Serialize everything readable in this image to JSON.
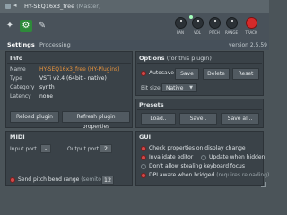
{
  "window": {
    "title": "HY-SEQ16x3_free",
    "title_suffix": "(Master)"
  },
  "header": {
    "knobs": [
      {
        "label": "PAN",
        "name": "pan"
      },
      {
        "label": "VOL",
        "name": "volume"
      },
      {
        "label": "PITCH",
        "name": "pitch"
      },
      {
        "label": "RANGE",
        "name": "range"
      },
      {
        "label": "TRACK",
        "name": "track"
      }
    ],
    "accent_color": "#2e8a3a"
  },
  "tabs": {
    "items": [
      "Settings",
      "Processing"
    ],
    "active": "Settings",
    "version": "version 2.5.59"
  },
  "info": {
    "title": "Info",
    "rows": [
      {
        "label": "Name",
        "value": "HY-SEQ16x3_free (HY-Plugins)"
      },
      {
        "label": "Type",
        "value": "VSTi v2.4 (64bit - native)"
      },
      {
        "label": "Category",
        "value": "synth"
      },
      {
        "label": "Latency",
        "value": "none"
      }
    ],
    "reload_label": "Reload plugin",
    "refresh_label": "Refresh plugin properties"
  },
  "options": {
    "title": "Options",
    "title_sub": "(for this plugin)",
    "autosave_label": "Autosave",
    "save_label": "Save",
    "delete_label": "Delete",
    "reset_label": "Reset",
    "bit_size_label": "Bit size",
    "bit_size_value": "Native"
  },
  "presets": {
    "title": "Presets",
    "load_label": "Load..",
    "save_label": "Save..",
    "save_all_label": "Save all.."
  },
  "midi": {
    "title": "MIDI",
    "input_port_label": "Input port",
    "input_port_value": "-",
    "output_port_label": "Output port",
    "output_port_value": "2",
    "pitch_bend_label": "Send pitch bend range",
    "pitch_bend_sub": "(semitones)",
    "pitch_bend_value": "12"
  },
  "gui": {
    "title": "GUI",
    "check_props": "Check properties on display change",
    "invalidate": "Invalidate editor",
    "update_hidden": "Update when hidden",
    "dont_steal": "Don't allow stealing keyboard focus",
    "dpi_aware": "DPI aware when bridged",
    "dpi_aware_sub": "(requires reloading)"
  }
}
